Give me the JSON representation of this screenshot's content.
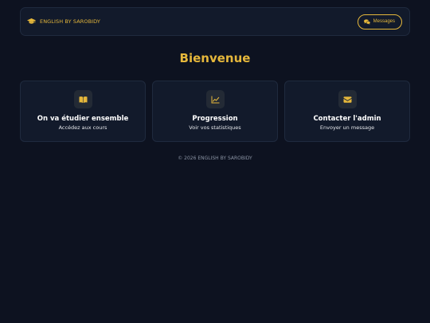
{
  "navbar": {
    "brand_icon": "graduation-cap-icon",
    "brand_text": "ENGLISH BY SAROBIDY",
    "messages_icon": "chat-bubbles-icon",
    "messages_label": "Messages"
  },
  "main": {
    "title": "Bienvenue",
    "cards": [
      {
        "icon": "book-open-icon",
        "title": "On va étudier ensemble",
        "subtitle": "Accédez aux cours"
      },
      {
        "icon": "line-chart-icon",
        "title": "Progression",
        "subtitle": "Voir vos statistiques"
      },
      {
        "icon": "envelope-icon",
        "title": "Contacter l'admin",
        "subtitle": "Envoyer un message"
      }
    ]
  },
  "footer": {
    "text": "© 2026 ENGLISH BY SAROBIDY"
  },
  "colors": {
    "background": "#0d1220",
    "panel": "#121a2b",
    "accent": "#e5b73b",
    "icon_tile": "#232a35"
  }
}
